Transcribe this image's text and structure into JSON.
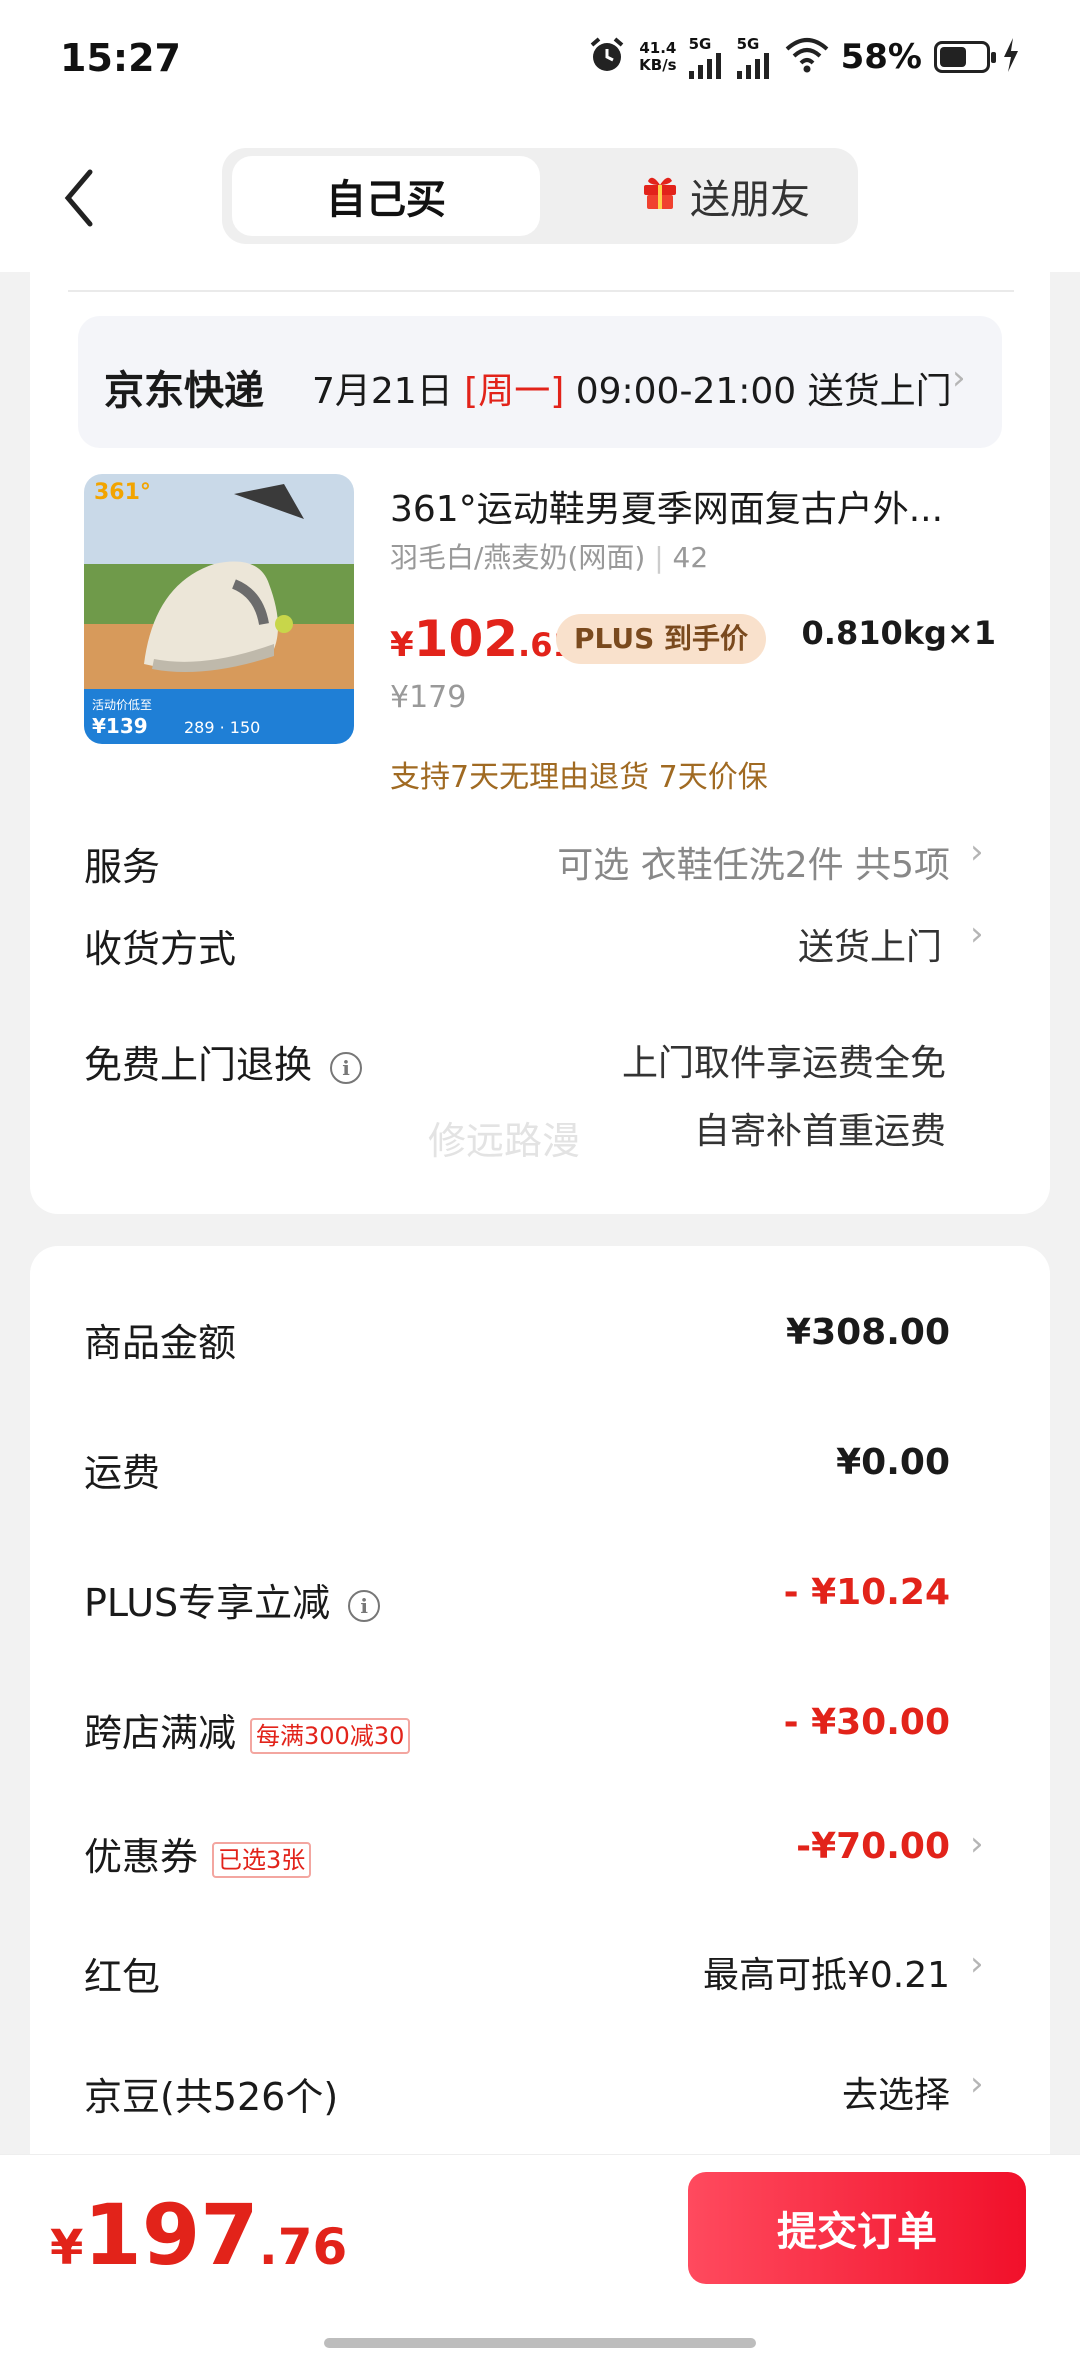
{
  "status_bar": {
    "time": "15:27",
    "net_speed_value": "41.4",
    "net_speed_unit": "KB/s",
    "sim1": "5G",
    "sim2": "5G",
    "battery": "58%",
    "battery_level": 0.58
  },
  "header": {
    "tab_self": "自己买",
    "tab_gift": "送朋友"
  },
  "delivery": {
    "carrier": "京东快递",
    "date": "7月21日",
    "weekday": "[周一]",
    "time_window": "09:00-21:00 送货上门"
  },
  "product": {
    "title": "361°运动鞋男夏季网面复古户外...",
    "spec": "羽毛白/燕麦奶(网面)",
    "size": "42",
    "price_symbol": "¥",
    "price_int": "102",
    "price_dec": ".61",
    "plus_tag": "PLUS 到手价",
    "weight_qty": "0.810kg×1",
    "old_price": "¥179",
    "policy": "支持7天无理由退货  7天价保",
    "thumb": {
      "brand": "361°",
      "banner_text": "活动价低至",
      "banner_price": "¥139",
      "banner_nums": "289 · 150"
    }
  },
  "options": {
    "service_label": "服务",
    "service_value": "可选 衣鞋任洗2件 共5项",
    "shipping_label": "收货方式",
    "shipping_value": "送货上门",
    "return_label": "免费上门退换",
    "return_value_1": "上门取件享运费全免",
    "return_value_2": "自寄补首重运费",
    "watermark": "修远路漫"
  },
  "summary": {
    "goods_label": "商品金额",
    "goods_value": "¥308.00",
    "freight_label": "运费",
    "freight_value": "¥0.00",
    "plus_label": "PLUS专享立减",
    "plus_value": "- ¥10.24",
    "cross_label": "跨店满减",
    "cross_badge": "每满300减30",
    "cross_value": "- ¥30.00",
    "coupon_label": "优惠券",
    "coupon_badge": "已选3张",
    "coupon_value": "-¥70.00",
    "redpacket_label": "红包",
    "redpacket_value": "最高可抵¥0.21",
    "beans_label": "京豆(共526个)",
    "beans_value": "去选择"
  },
  "footer": {
    "total_symbol": "¥",
    "total_int": "197",
    "total_dec": ".76",
    "submit_label": "提交订单"
  },
  "colors": {
    "accent_red": "#e2231a",
    "plus_bg": "#f9e1cc",
    "policy_gold": "#a06a22"
  }
}
